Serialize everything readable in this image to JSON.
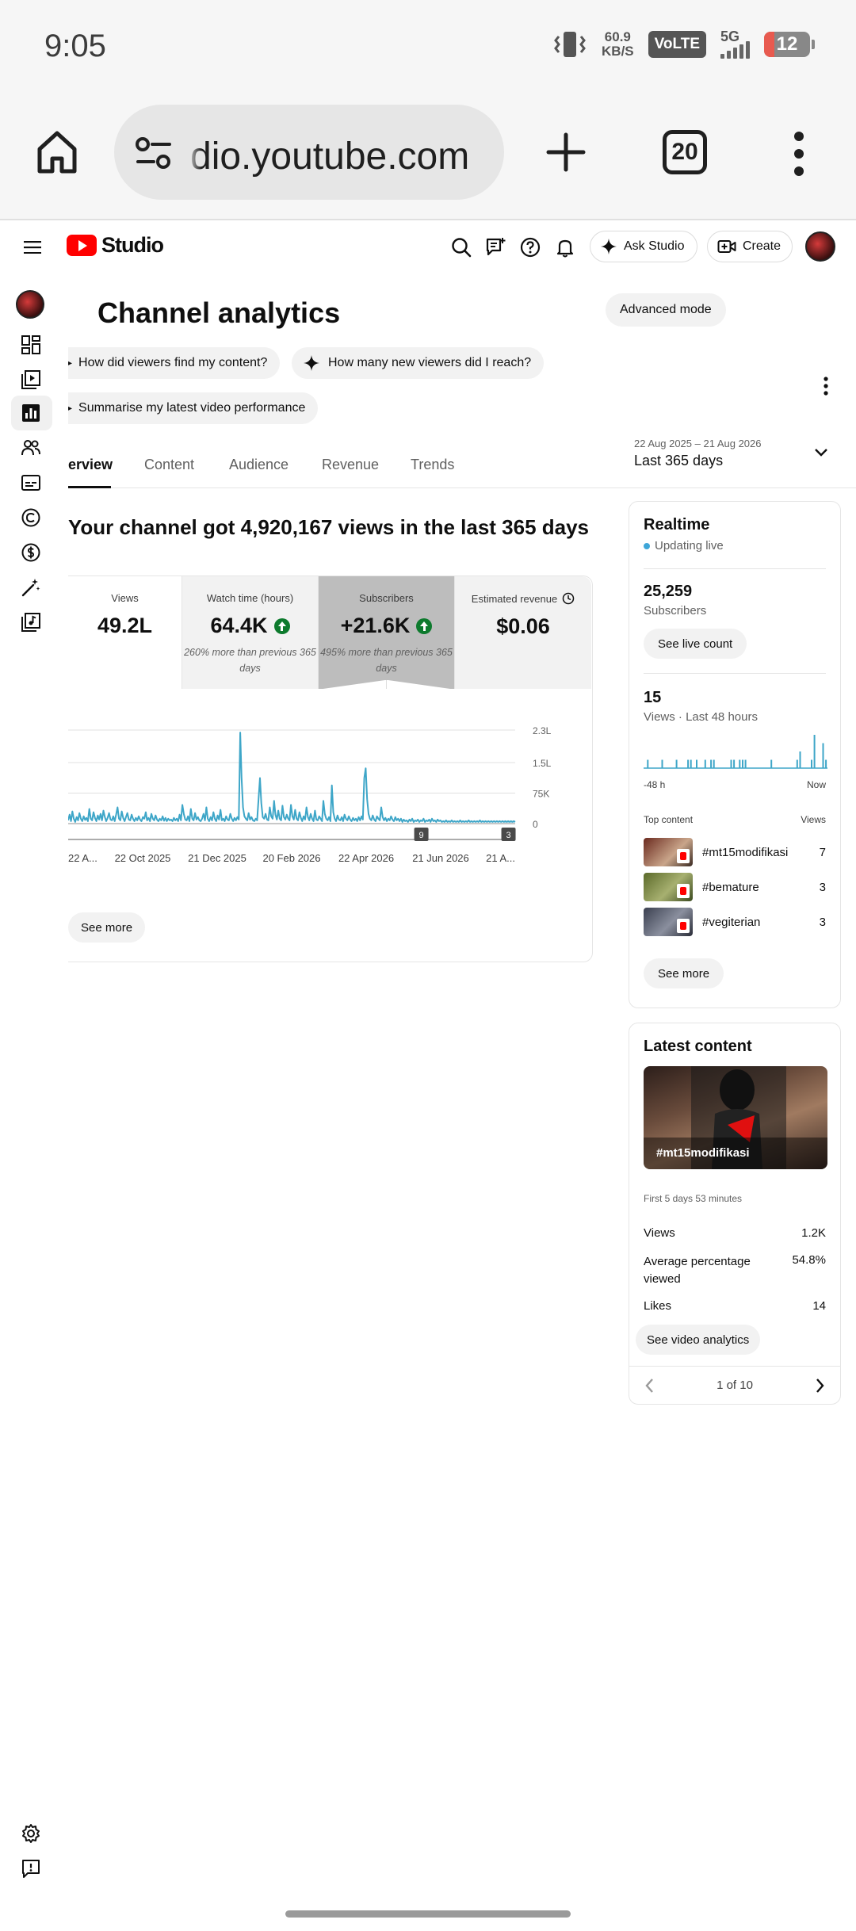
{
  "status_bar": {
    "time": "9:05",
    "net_speed_value": "60.9",
    "net_speed_unit": "KB/S",
    "volte": "VoLTE",
    "network": "5G",
    "battery": "12"
  },
  "browser": {
    "url": "dio.youtube.com",
    "tab_count": "20"
  },
  "header": {
    "logo_text": "Studio",
    "ask_studio": "Ask Studio",
    "create": "Create"
  },
  "page": {
    "title": "Channel analytics",
    "advanced_mode": "Advanced mode",
    "chips": [
      "How did viewers find my content?",
      "How many new viewers did I reach?",
      "Summarise my latest video performance"
    ],
    "tabs": [
      "erview",
      "Content",
      "Audience",
      "Revenue",
      "Trends"
    ],
    "date_range_sub": "22 Aug 2025 – 21 Aug 2026",
    "date_range_main": "Last 365 days",
    "headline": "Your channel got 4,920,167 views in the last 365 days",
    "metrics": [
      {
        "label": "Views",
        "value": "49.2L",
        "note": ""
      },
      {
        "label": "Watch time (hours)",
        "value": "64.4K",
        "note": "260% more than previous 365 days"
      },
      {
        "label": "Subscribers",
        "value": "+21.6K",
        "note": "495% more than previous 365 days"
      },
      {
        "label": "Estimated revenue",
        "value": "$0.06",
        "note": ""
      }
    ],
    "see_more": "See more"
  },
  "chart_data": {
    "type": "line",
    "title": "",
    "series": [
      {
        "values": [
          40,
          110,
          30,
          150,
          60,
          20,
          80,
          40,
          130,
          60,
          30,
          90,
          45,
          70,
          30,
          180,
          60,
          40,
          140,
          70,
          30,
          100,
          50,
          120,
          40,
          160,
          80,
          30,
          70,
          130,
          50,
          40,
          90,
          30,
          110,
          200,
          60,
          40,
          150,
          70,
          30,
          80,
          130,
          50,
          40,
          110,
          60,
          30,
          70,
          40,
          90,
          50,
          30,
          80,
          60,
          140,
          40,
          70,
          30,
          120,
          60,
          40,
          100,
          50,
          30,
          60,
          40,
          90,
          35,
          70,
          30,
          60,
          40,
          50,
          30,
          70,
          40,
          60,
          30,
          110,
          40,
          230,
          120,
          50,
          40,
          90,
          30,
          180,
          60,
          40,
          130,
          50,
          80,
          40,
          30,
          60,
          120,
          40,
          200,
          60,
          30,
          80,
          40,
          140,
          60,
          30,
          100,
          50,
          170,
          40,
          60,
          30,
          90,
          50,
          40,
          120,
          60,
          30,
          70,
          40,
          80,
          50,
          1120,
          560,
          200,
          90,
          60,
          40,
          130,
          50,
          80,
          40,
          30,
          60,
          40,
          300,
          560,
          250,
          80,
          60,
          120,
          50,
          40,
          200,
          90,
          60,
          280,
          110,
          50,
          160,
          60,
          40,
          220,
          80,
          50,
          110,
          60,
          40,
          230,
          90,
          50,
          170,
          60,
          40,
          140,
          70,
          30,
          90,
          50,
          200,
          80,
          40,
          120,
          60,
          30,
          160,
          50,
          40,
          90,
          60,
          30,
          280,
          120,
          60,
          40,
          80,
          30,
          470,
          140,
          60,
          30,
          100,
          50,
          40,
          80,
          30,
          110,
          60,
          40,
          90,
          50,
          30,
          70,
          40,
          60,
          30,
          80,
          40,
          90,
          50,
          560,
          680,
          300,
          120,
          60,
          40,
          100,
          50,
          30,
          90,
          60,
          40,
          200,
          80,
          40,
          70,
          30,
          60,
          40,
          90,
          50,
          30,
          80,
          40,
          60,
          30,
          60,
          20,
          50,
          30,
          40,
          20,
          50,
          30,
          60,
          20,
          40,
          30,
          50,
          20,
          40,
          30,
          60,
          20,
          40,
          30,
          50,
          20,
          60,
          30,
          40,
          20,
          50,
          30,
          40,
          20,
          30,
          20,
          40,
          20,
          30,
          20,
          40,
          20,
          30,
          20,
          30,
          20,
          40,
          20,
          30,
          20,
          30,
          20,
          40,
          20,
          30,
          20,
          30,
          20,
          30,
          20,
          40,
          20,
          30,
          20,
          30,
          20,
          30,
          20,
          30,
          20,
          30,
          20,
          30,
          20,
          30,
          20,
          30,
          20,
          30,
          20,
          30,
          20,
          30,
          20,
          30,
          20
        ]
      }
    ],
    "x_tick_labels": [
      "22 A...",
      "22 Oct 2025",
      "21 Dec 2025",
      "20 Feb 2026",
      "22 Apr 2026",
      "21 Jun 2026",
      "21 A..."
    ],
    "y_tick_labels": [
      "0",
      "75K",
      "1.5L",
      "2.3L"
    ],
    "y_ticks": [
      0,
      75000,
      150000,
      230000
    ],
    "ylim": [
      0,
      230000
    ],
    "value_scale": 200,
    "grid": true,
    "markers": [
      {
        "label": "9",
        "x_fraction": 0.79
      },
      {
        "label": "3",
        "x_fraction": 0.985
      }
    ],
    "line_color": "#3ea6c8"
  },
  "realtime": {
    "title": "Realtime",
    "live_status": "Updating live",
    "subscribers_value": "25,259",
    "subscribers_label": "Subscribers",
    "see_live_count": "See live count",
    "views_value": "15",
    "views_label": "Views · Last 48 hours",
    "axis_start": "-48 h",
    "axis_end": "Now",
    "bars": [
      0,
      1,
      0,
      0,
      0,
      0,
      1,
      0,
      0,
      0,
      0,
      1,
      0,
      0,
      0,
      1,
      1,
      0,
      1,
      0,
      0,
      1,
      0,
      1,
      1,
      0,
      0,
      0,
      0,
      0,
      1,
      1,
      0,
      1,
      1,
      1,
      0,
      0,
      0,
      0,
      0,
      0,
      0,
      0,
      1,
      0,
      0,
      0,
      0,
      0,
      0,
      0,
      0,
      1,
      2,
      0,
      0,
      0,
      1,
      4,
      0,
      0,
      3,
      1
    ],
    "bar_max": 4,
    "top_content_label": "Top content",
    "views_col_label": "Views",
    "top_content": [
      {
        "title": "#mt15modifikasi",
        "views": "7"
      },
      {
        "title": "#bemature",
        "views": "3"
      },
      {
        "title": "#vegiterian",
        "views": "3"
      }
    ],
    "see_more": "See more"
  },
  "latest": {
    "title": "Latest content",
    "thumb_title": "#mt15modifikasi",
    "period": "First 5 days 53 minutes",
    "stats": [
      {
        "label": "Views",
        "value": "1.2K"
      },
      {
        "label": "Average percentage viewed",
        "value": "54.8%"
      },
      {
        "label": "Likes",
        "value": "14"
      }
    ],
    "see_video_analytics": "See video analytics",
    "pager": "1 of 10"
  }
}
